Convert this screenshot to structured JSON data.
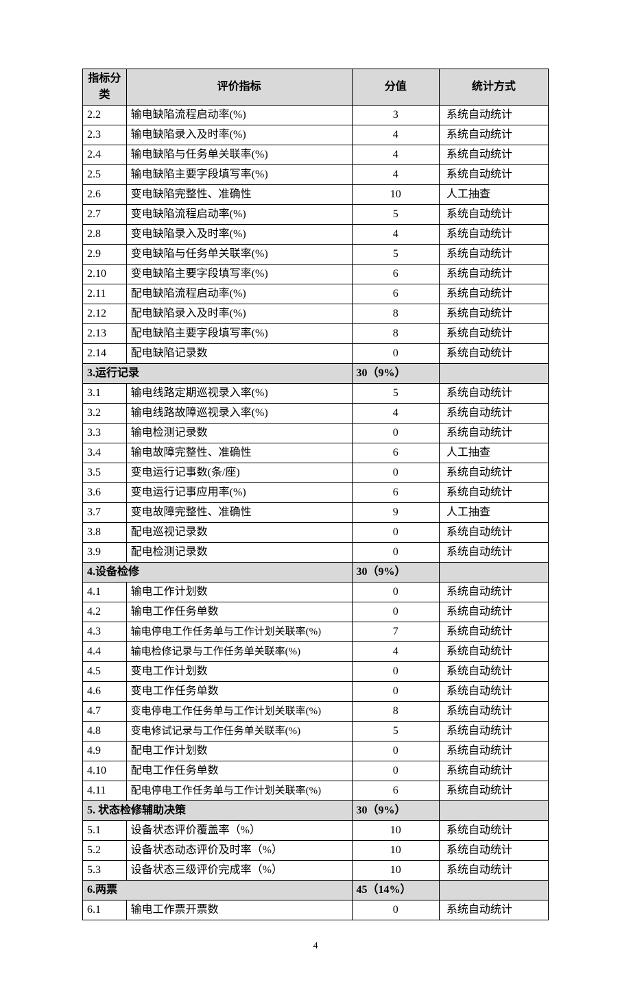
{
  "headers": {
    "category": "指标分类",
    "indicator": "评价指标",
    "score": "分值",
    "method": "统计方式"
  },
  "rows": [
    {
      "type": "row",
      "idx": "2.2",
      "name": "输电缺陷流程启动率(%)",
      "score": "3",
      "method": "系统自动统计"
    },
    {
      "type": "row",
      "idx": "2.3",
      "name": "输电缺陷录入及时率(%)",
      "score": "4",
      "method": "系统自动统计"
    },
    {
      "type": "row",
      "idx": "2.4",
      "name": "输电缺陷与任务单关联率(%)",
      "score": "4",
      "method": "系统自动统计"
    },
    {
      "type": "row",
      "idx": "2.5",
      "name": "输电缺陷主要字段填写率(%)",
      "score": "4",
      "method": "系统自动统计"
    },
    {
      "type": "row",
      "idx": "2.6",
      "name": "变电缺陷完整性、准确性",
      "score": "10",
      "method": "人工抽查"
    },
    {
      "type": "row",
      "idx": "2.7",
      "name": "变电缺陷流程启动率(%)",
      "score": "5",
      "method": "系统自动统计"
    },
    {
      "type": "row",
      "idx": "2.8",
      "name": "变电缺陷录入及时率(%)",
      "score": "4",
      "method": "系统自动统计"
    },
    {
      "type": "row",
      "idx": "2.9",
      "name": "变电缺陷与任务单关联率(%)",
      "score": "5",
      "method": "系统自动统计"
    },
    {
      "type": "row",
      "idx": "2.10",
      "name": "变电缺陷主要字段填写率(%)",
      "score": "6",
      "method": "系统自动统计"
    },
    {
      "type": "row",
      "idx": "2.11",
      "name": "配电缺陷流程启动率(%)",
      "score": "6",
      "method": "系统自动统计"
    },
    {
      "type": "row",
      "idx": "2.12",
      "name": "配电缺陷录入及时率(%)",
      "score": "8",
      "method": "系统自动统计"
    },
    {
      "type": "row",
      "idx": "2.13",
      "name": "配电缺陷主要字段填写率(%)",
      "score": "8",
      "method": "系统自动统计"
    },
    {
      "type": "row",
      "idx": "2.14",
      "name": "配电缺陷记录数",
      "score": "0",
      "method": "系统自动统计"
    },
    {
      "type": "section",
      "title": "3.运行记录",
      "score": "30（9%）"
    },
    {
      "type": "row",
      "idx": "3.1",
      "name": "输电线路定期巡视录入率(%)",
      "score": "5",
      "method": "系统自动统计"
    },
    {
      "type": "row",
      "idx": "3.2",
      "name": "输电线路故障巡视录入率(%)",
      "score": "4",
      "method": "系统自动统计"
    },
    {
      "type": "row",
      "idx": "3.3",
      "name": "输电检测记录数",
      "score": "0",
      "method": "系统自动统计"
    },
    {
      "type": "row",
      "idx": "3.4",
      "name": "输电故障完整性、准确性",
      "score": "6",
      "method": "人工抽查"
    },
    {
      "type": "row",
      "idx": "3.5",
      "name": "变电运行记事数(条/座)",
      "score": "0",
      "method": "系统自动统计"
    },
    {
      "type": "row",
      "idx": "3.6",
      "name": "变电运行记事应用率(%)",
      "score": "6",
      "method": "系统自动统计"
    },
    {
      "type": "row",
      "idx": "3.7",
      "name": "变电故障完整性、准确性",
      "score": "9",
      "method": "人工抽查"
    },
    {
      "type": "row",
      "idx": "3.8",
      "name": "配电巡视记录数",
      "score": "0",
      "method": "系统自动统计"
    },
    {
      "type": "row",
      "idx": "3.9",
      "name": "配电检测记录数",
      "score": "0",
      "method": "系统自动统计"
    },
    {
      "type": "section",
      "title": "4.设备检修",
      "score": "30（9%）"
    },
    {
      "type": "row",
      "idx": "4.1",
      "name": "输电工作计划数",
      "score": "0",
      "method": "系统自动统计"
    },
    {
      "type": "row",
      "idx": "4.2",
      "name": "输电工作任务单数",
      "score": "0",
      "method": "系统自动统计"
    },
    {
      "type": "row",
      "idx": "4.3",
      "name": "输电停电工作任务单与工作计划关联率(%)",
      "score": "7",
      "method": "系统自动统计",
      "small": true
    },
    {
      "type": "row",
      "idx": "4.4",
      "name": "输电检修记录与工作任务单关联率(%)",
      "score": "4",
      "method": "系统自动统计",
      "small": true
    },
    {
      "type": "row",
      "idx": "4.5",
      "name": "变电工作计划数",
      "score": "0",
      "method": "系统自动统计"
    },
    {
      "type": "row",
      "idx": "4.6",
      "name": "变电工作任务单数",
      "score": "0",
      "method": "系统自动统计"
    },
    {
      "type": "row",
      "idx": "4.7",
      "name": "变电停电工作任务单与工作计划关联率(%)",
      "score": "8",
      "method": "系统自动统计",
      "small": true
    },
    {
      "type": "row",
      "idx": "4.8",
      "name": "变电修试记录与工作任务单关联率(%)",
      "score": "5",
      "method": "系统自动统计",
      "small": true
    },
    {
      "type": "row",
      "idx": "4.9",
      "name": "配电工作计划数",
      "score": "0",
      "method": "系统自动统计"
    },
    {
      "type": "row",
      "idx": "4.10",
      "name": "配电工作任务单数",
      "score": "0",
      "method": "系统自动统计"
    },
    {
      "type": "row",
      "idx": "4.11",
      "name": "配电停电工作任务单与工作计划关联率(%)",
      "score": "6",
      "method": "系统自动统计",
      "small": true
    },
    {
      "type": "section",
      "title": "5. 状态检修辅助决策",
      "score": "30（9%）"
    },
    {
      "type": "row",
      "idx": "5.1",
      "name": "设备状态评价覆盖率（%）",
      "score": "10",
      "method": "系统自动统计"
    },
    {
      "type": "row",
      "idx": "5.2",
      "name": "设备状态动态评价及时率（%）",
      "score": "10",
      "method": "系统自动统计"
    },
    {
      "type": "row",
      "idx": "5.3",
      "name": "设备状态三级评价完成率（%）",
      "score": "10",
      "method": "系统自动统计"
    },
    {
      "type": "section",
      "title": "6.两票",
      "score": "45（14%）"
    },
    {
      "type": "row",
      "idx": "6.1",
      "name": "输电工作票开票数",
      "score": "0",
      "method": "系统自动统计"
    }
  ],
  "page_number": "4"
}
